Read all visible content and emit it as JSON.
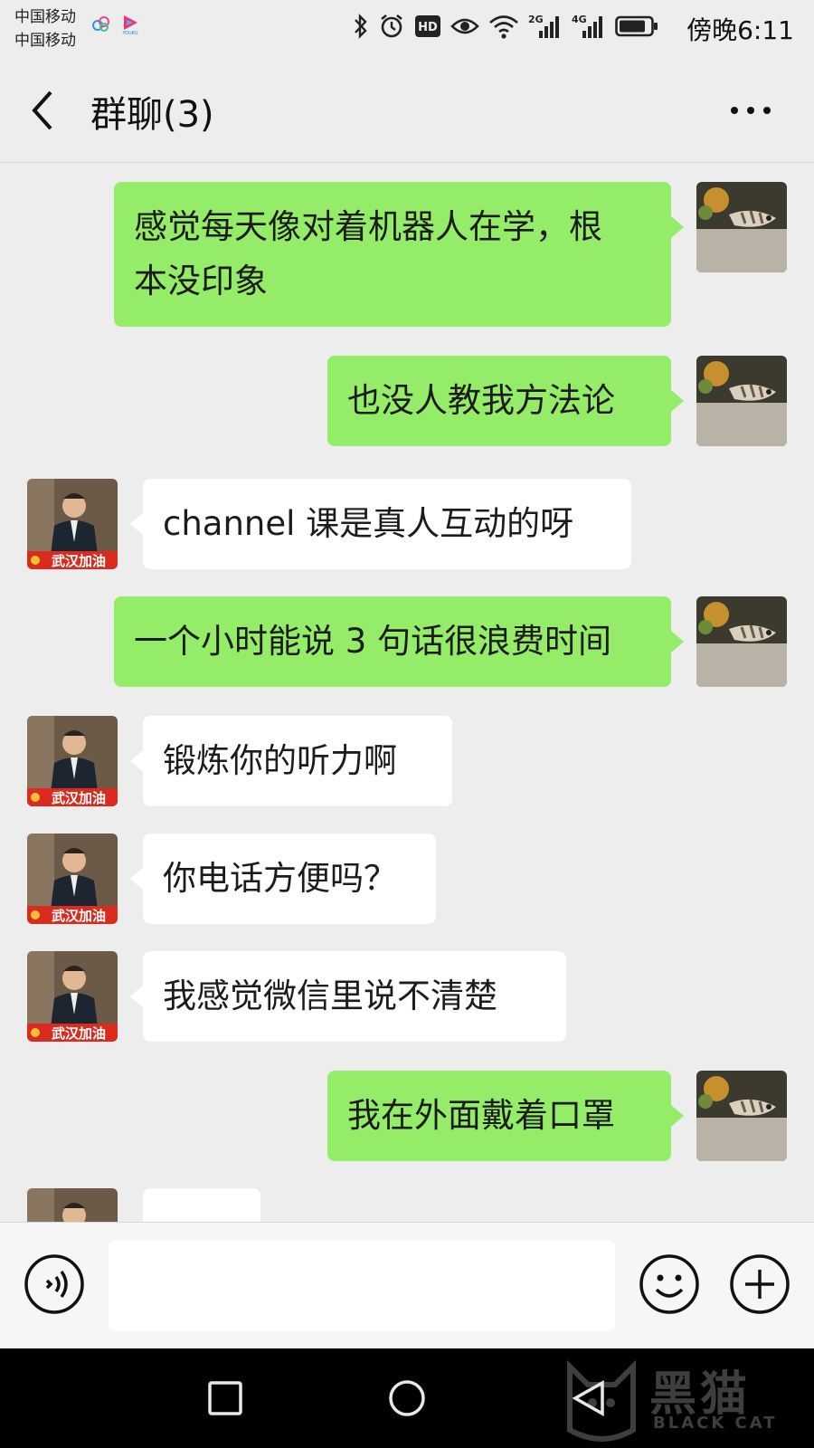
{
  "status_bar": {
    "carrier_1": "中国移动",
    "carrier_2": "中国移动",
    "network_2g": "2G",
    "network_4g": "4G",
    "hd": "HD",
    "time": "傍晚6:11",
    "icons": [
      "baidu-cloud-icon",
      "youku-icon",
      "bluetooth-icon",
      "alarm-icon",
      "hd-icon",
      "eye-icon",
      "wifi-icon",
      "signal-icon",
      "battery-icon"
    ]
  },
  "header": {
    "title": "群聊(3)",
    "back_icon": "chevron-left-icon",
    "more_icon": "more-dots-icon"
  },
  "messages": [
    {
      "sender": "me",
      "lines": [
        "感觉每天像对着机器人在学，根",
        "本没印象"
      ]
    },
    {
      "sender": "me",
      "lines": [
        "也没人教我方法论"
      ]
    },
    {
      "sender": "other",
      "lines": [
        "channel 课是真人互动的呀"
      ]
    },
    {
      "sender": "me",
      "lines": [
        "一个小时能说 3 句话很浪费时间"
      ]
    },
    {
      "sender": "other",
      "lines": [
        "锻炼你的听力啊"
      ]
    },
    {
      "sender": "other",
      "lines": [
        "你电话方便吗？"
      ]
    },
    {
      "sender": "other",
      "lines": [
        "我感觉微信里说不清楚"
      ]
    },
    {
      "sender": "me",
      "lines": [
        "我在外面戴着口罩"
      ]
    },
    {
      "sender": "other",
      "lines": [
        ""
      ]
    }
  ],
  "avatar_badge": "武汉加油",
  "input_bar": {
    "placeholder": "",
    "voice_icon": "voice-icon",
    "emoji_icon": "emoji-icon",
    "plus_icon": "plus-circle-icon"
  },
  "nav_bar": {
    "icons": [
      "recent-apps-icon",
      "home-icon",
      "back-icon"
    ],
    "watermark": "黑猫",
    "watermark_sub": "BLACK CAT"
  },
  "colors": {
    "bg": "#ededed",
    "my_bubble": "#95ec69",
    "other_bubble": "#ffffff",
    "badge": "#d92c1f"
  }
}
